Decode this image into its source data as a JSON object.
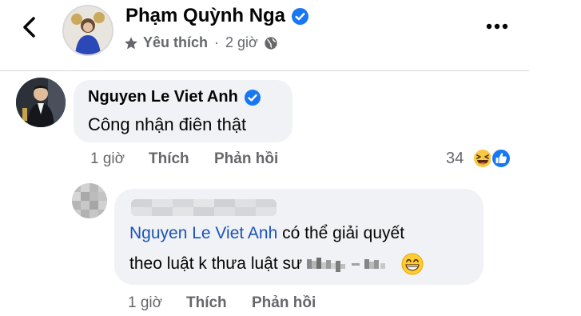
{
  "header": {
    "back_icon": "chevron-left-icon",
    "name": "Phạm Quỳnh Nga",
    "verified_icon": "verified-badge-icon",
    "status_icon": "star-icon",
    "status_label": "Yêu thích",
    "separator": "·",
    "time": "2 giờ",
    "audience_icon": "globe-icon",
    "more_icon": "more-dots-icon"
  },
  "comment": {
    "author": "Nguyen Le Viet Anh",
    "text": "Công nhận điên thật",
    "time": "1 giờ",
    "like_label": "Thích",
    "reply_label": "Phản hồi",
    "reaction_count": "34",
    "reaction_icons": [
      "haha-reaction-icon",
      "like-reaction-icon"
    ]
  },
  "reply": {
    "author_blurred": true,
    "mention": "Nguyen Le Viet Anh",
    "line1_rest": " có thể giải quyết",
    "line2": "theo luật k thưa luật sư",
    "emoji_icon": "grinning-emoji-icon",
    "time": "1 giờ",
    "like_label": "Thích",
    "reply_label": "Phản hồi"
  },
  "colors": {
    "accent": "#1877f2",
    "mention": "#1b53b8",
    "secondary_text": "#65676b",
    "bubble": "#f0f2f5"
  }
}
